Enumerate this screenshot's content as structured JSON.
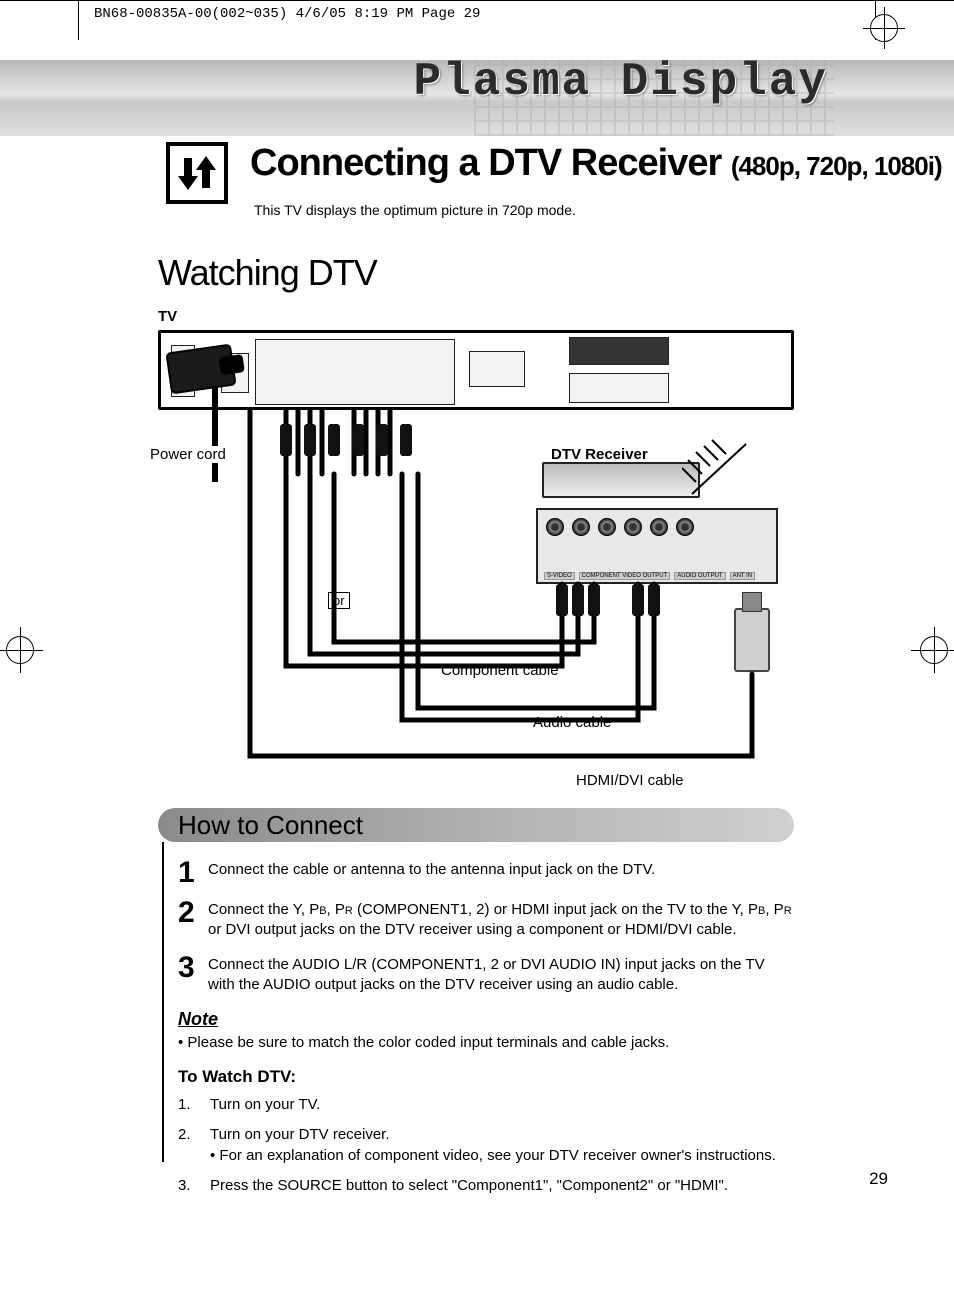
{
  "print_info": "BN68-00835A-00(002~035)  4/6/05  8:19 PM  Page 29",
  "category_title": "Plasma Display",
  "main_title_a": "Connecting a DTV Receiver",
  "main_title_b": "(480p, 720p, 1080i)",
  "intro": "This TV displays the optimum picture in 720p mode.",
  "section_watching": "Watching DTV",
  "tv_label": "TV",
  "callouts": {
    "power": "Power cord",
    "or": "or",
    "dtv": "DTV Receiver",
    "component": "Component cable",
    "audio": "Audio cable",
    "hdmi": "HDMI/DVI cable"
  },
  "receiver_jacks": [
    "S-VIDEO",
    "COMPONENT VIDEO OUTPUT",
    "AUDIO OUTPUT",
    "ANT IN"
  ],
  "howto_title": "How to Connect",
  "steps": [
    {
      "n": "1",
      "t": "Connect the cable or antenna to the antenna input jack on the DTV."
    },
    {
      "n": "2",
      "t": "Connect the Y, PB, PR (COMPONENT1, 2) or HDMI input jack on the TV to the Y, PB, PR or DVI output jacks on the DTV receiver using a component or HDMI/DVI cable."
    },
    {
      "n": "3",
      "t": "Connect the AUDIO L/R (COMPONENT1, 2 or DVI AUDIO IN) input jacks on the TV with the AUDIO output jacks on the DTV receiver using an audio cable."
    }
  ],
  "note_heading": "Note",
  "note_text": "•  Please be sure to match the color coded input terminals and cable jacks.",
  "watch_heading": "To Watch DTV:",
  "watch_steps": [
    {
      "n": "1.",
      "t": "Turn on your TV."
    },
    {
      "n": "2.",
      "t": "Turn on your DTV receiver.\n• For an explanation of component video, see your DTV receiver owner's instructions."
    },
    {
      "n": "3.",
      "t": "Press the SOURCE button to select \"Component1\", \"Component2\" or \"HDMI\"."
    }
  ],
  "page_number": "29"
}
